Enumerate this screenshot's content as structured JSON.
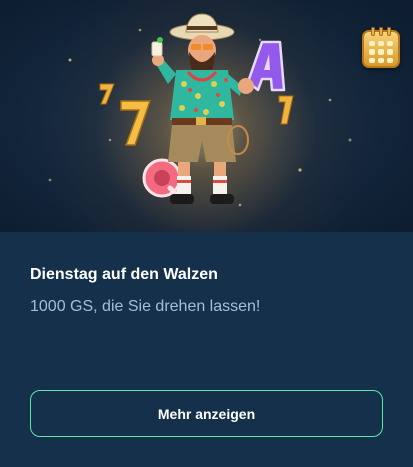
{
  "promo": {
    "title": "Dienstag auf den Walzen",
    "description": "1000 GS, die Sie drehen lassen!",
    "button_label": "Mehr anzeigen"
  },
  "hero": {
    "illustration": "cowboy-character-with-slot-symbols",
    "badge_icon": "calendar-icon"
  },
  "colors": {
    "card_background": "#14304b",
    "button_border": "#5ee6a5",
    "title": "#ffffff",
    "description": "#9fc0d8",
    "accent_gold": "#f0b43c",
    "accent_purple": "#8a4fe0",
    "accent_pink": "#f06b7a"
  }
}
